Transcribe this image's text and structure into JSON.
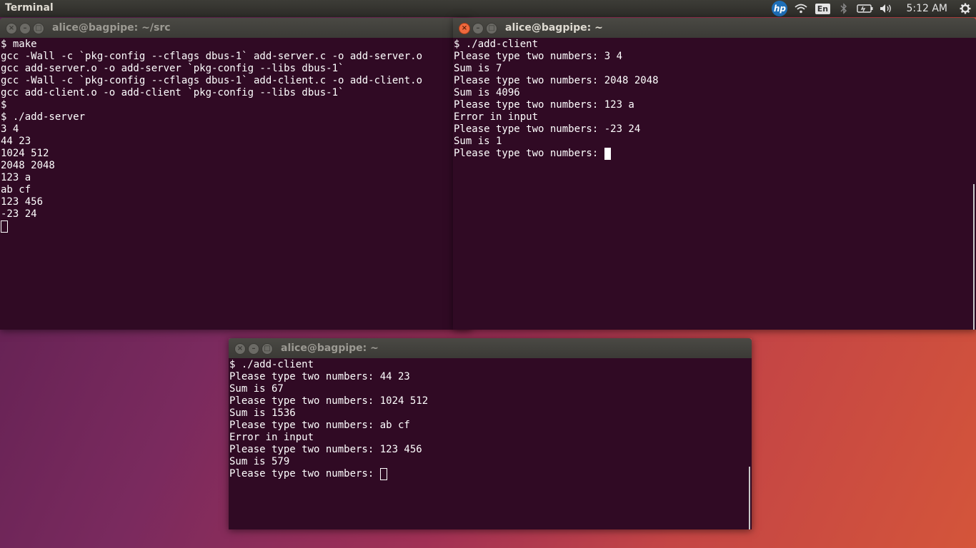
{
  "panel": {
    "app_title": "Terminal",
    "hp_label": "hp",
    "wifi_icon": "wifi-icon",
    "lang": "En",
    "bluetooth_icon": "bluetooth-icon",
    "battery_icon": "battery-icon",
    "volume_icon": "volume-icon",
    "time": "5:12 AM",
    "gear_icon": "gear-icon"
  },
  "windows": {
    "server": {
      "title": "alice@bagpipe: ~/src",
      "lines": [
        "$ make",
        "gcc -Wall -c `pkg-config --cflags dbus-1` add-server.c -o add-server.o",
        "gcc add-server.o -o add-server `pkg-config --libs dbus-1`",
        "gcc -Wall -c `pkg-config --cflags dbus-1` add-client.c -o add-client.o",
        "gcc add-client.o -o add-client `pkg-config --libs dbus-1`",
        "$",
        "$ ./add-server",
        "3 4",
        "44 23",
        "1024 512",
        "2048 2048",
        "123 a",
        "ab cf",
        "123 456",
        "-23 24"
      ]
    },
    "client1": {
      "title": "alice@bagpipe: ~",
      "lines": [
        "$ ./add-client",
        "Please type two numbers: 3 4",
        "Sum is 7",
        "Please type two numbers: 2048 2048",
        "Sum is 4096",
        "Please type two numbers: 123 a",
        "Error in input",
        "Please type two numbers: -23 24",
        "Sum is 1"
      ],
      "prompt": "Please type two numbers: "
    },
    "client2": {
      "title": "alice@bagpipe: ~",
      "lines": [
        "$ ./add-client",
        "Please type two numbers: 44 23",
        "Sum is 67",
        "Please type two numbers: 1024 512",
        "Sum is 1536",
        "Please type two numbers: ab cf",
        "Error in input",
        "Please type two numbers: 123 456",
        "Sum is 579"
      ],
      "prompt": "Please type two numbers: "
    }
  }
}
